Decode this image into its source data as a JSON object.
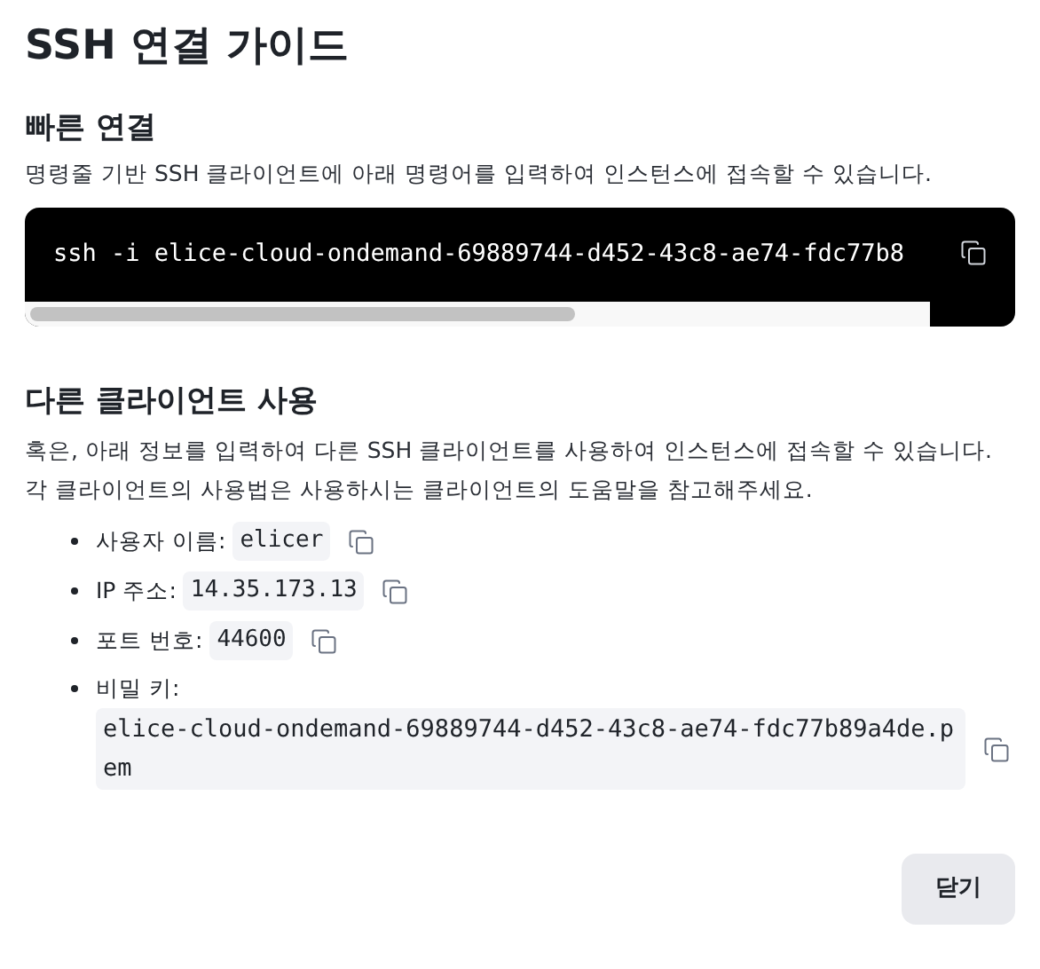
{
  "title": "SSH 연결 가이드",
  "quick": {
    "heading": "빠른 연결",
    "description": "명령줄 기반 SSH 클라이언트에 아래 명령어를 입력하여 인스턴스에 접속할 수 있습니다.",
    "command": "ssh -i elice-cloud-ondemand-69889744-d452-43c8-ae74-fdc77b8"
  },
  "other": {
    "heading": "다른 클라이언트 사용",
    "description": "혹은, 아래 정보를 입력하여 다른 SSH 클라이언트를 사용하여 인스턴스에 접속할 수 있습니다. 각 클라이언트의 사용법은 사용하시는 클라이언트의 도움말을 참고해주세요.",
    "items": [
      {
        "label": "사용자 이름:",
        "value": "elicer",
        "kind": "inline"
      },
      {
        "label": "IP 주소:",
        "value": "14.35.173.13",
        "kind": "inline"
      },
      {
        "label": "포트 번호:",
        "value": "44600",
        "kind": "inline"
      },
      {
        "label": "비밀 키:",
        "value": "elice-cloud-ondemand-69889744-d452-43c8-ae74-fdc77b89a4de.pem",
        "kind": "block"
      }
    ]
  },
  "buttons": [
    "닫기"
  ]
}
